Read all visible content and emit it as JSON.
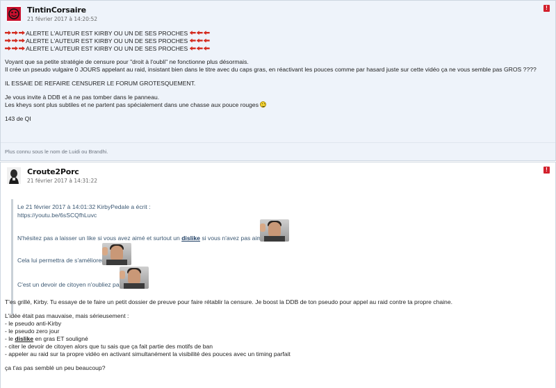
{
  "posts": [
    {
      "author": "TintinCorsaire",
      "date": "21 février 2017 à 14:20:52",
      "alert_label": "!",
      "lines": [
        "ALERTE L'AUTEUR EST KIRBY OU UN DE SES PROCHES",
        "ALERTE L'AUTEUR EST KIRBY OU UN DE SES PROCHES",
        "ALERTE L'AUTEUR EST KIRBY OU UN DE SES PROCHES"
      ],
      "p1": "Voyant que sa petite stratégie de censure pour \"droit à l'oubli\" ne fonctionne plus désormais.",
      "p2": "Il crée un pseudo vulgaire 0 JOURS appelant au raid, insistant bien dans le titre avec du caps gras, en réactivant les pouces comme par hasard juste sur cette vidéo ça ne vous semble pas GROS ????",
      "p3": "IL ESSAIE DE REFAIRE CENSURER LE FORUM GROTESQUEMENT.",
      "p4": "Je vous invite à DDB et à ne pas tomber dans le panneau.",
      "p5": "Les kheys sont plus subtiles et ne partent pas spécialement dans une chasse aux pouce rouges",
      "p6": "143 de QI",
      "signature": "Plus connu sous le nom de Luidi ou Brandhi."
    },
    {
      "author": "Croute2Porc",
      "date": "21 février 2017 à 14:31:22",
      "alert_label": "!",
      "quote": {
        "header": "Le 21 février 2017 à 14:01:32 KirbyPedale a écrit :",
        "link": "https://youtu.be/6sSCQfhLuvc",
        "line1_a": "N'hésitez pas a laisser un like si vous avez aimé et surtout un ",
        "line1_link": "dislike",
        "line1_b": " si vous n'avez pas aimé",
        "line2": "Cela lui permettra de s'améliorer",
        "line3": "C'est un devoir de citoyen n'oubliez pas"
      },
      "r1": "T'es grillé, Kirby. Tu essaye de te faire un petit dossier de preuve pour faire rétablir la censure. Je boost la DDB de ton pseudo pour appel au raid contre ta propre chaine.",
      "r2": "L'idée était pas mauvaise, mais sérieusement :",
      "r3": "- le pseudo anti-Kirby",
      "r4": "- le pseudo zero jour",
      "r5_a": "- le ",
      "r5_link": "dislike",
      "r5_b": " en gras ET souligné",
      "r6": "- citer le devoir de citoyen alors que tu sais que ça fait partie des motifs de ban",
      "r7": "- appeler au raid sur ta propre vidéo en activant simultanément la visibilité des pouces avec un timing parfait",
      "r8": "ça t'as pas semblé un peu beaucoup?"
    }
  ],
  "icons": {
    "arrow_color": "#d42a1e",
    "alert_color": "#d3212d"
  }
}
